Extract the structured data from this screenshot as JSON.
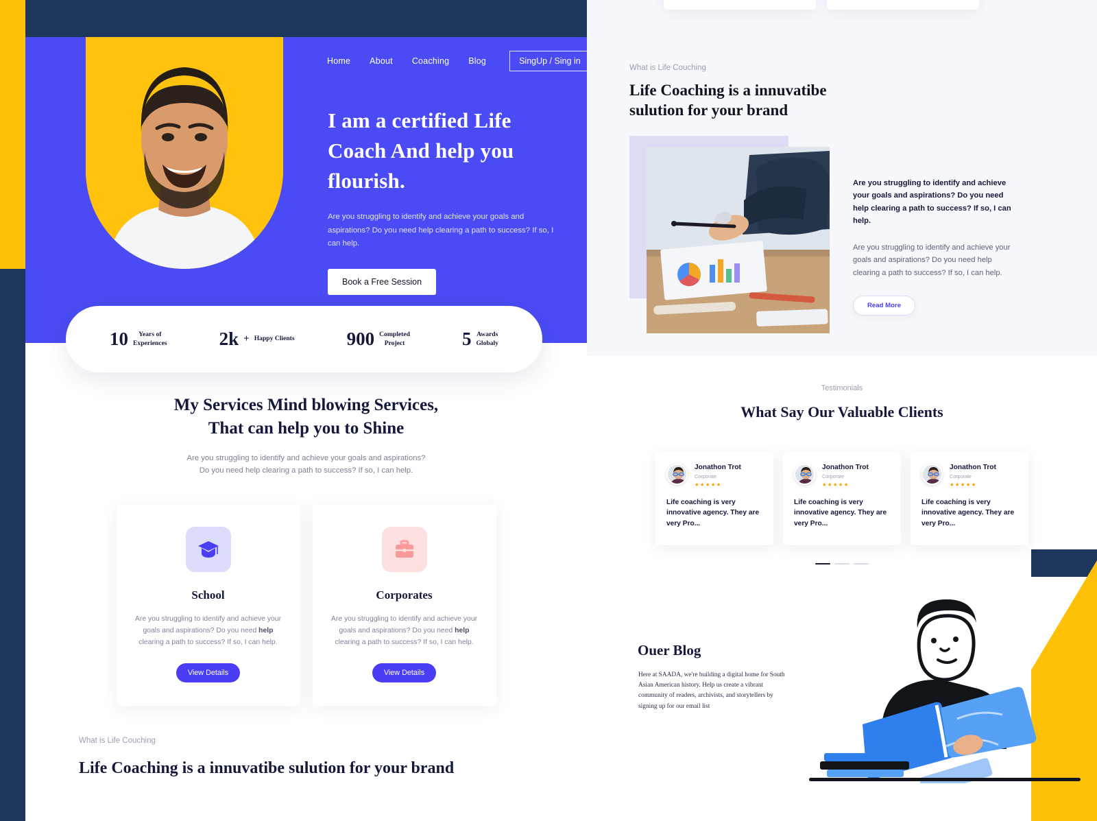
{
  "theme": {
    "primary_blue": "#4b4bf5",
    "button_blue": "#4b3df5",
    "yellow": "#ffc107",
    "navy": "#1d365c",
    "dark_text": "#14183a",
    "star_gold": "#f0a500"
  },
  "left_page": {
    "nav": {
      "links": [
        {
          "label": "Home"
        },
        {
          "label": "About"
        },
        {
          "label": "Coaching"
        },
        {
          "label": "Blog"
        }
      ],
      "auth_button": "SingUp /  Sing in"
    },
    "hero": {
      "title": "I am a certified Life Coach And help you flourish.",
      "subtitle": "Are you struggling to identify and achieve your goals and aspirations? Do you need help clearing a path to success? If so, I can help.",
      "cta_label": "Book a Free Session"
    },
    "stats": [
      {
        "number": "10",
        "plus": "",
        "label_line1": "Years of",
        "label_line2": "Experiences"
      },
      {
        "number": "2k",
        "plus": "+",
        "label_line1": "Happy Clients",
        "label_line2": ""
      },
      {
        "number": "900",
        "plus": "",
        "label_line1": "Completed",
        "label_line2": "Project"
      },
      {
        "number": "5",
        "plus": "",
        "label_line1": "Awards",
        "label_line2": "Globaly"
      }
    ],
    "services": {
      "title_line1": "My Services Mind blowing Services,",
      "title_line2": "That can help you to Shine",
      "subtitle_line1": "Are you struggling to identify and achieve your goals and aspirations?",
      "subtitle_line2": "Do you need help clearing a path to success? If so, I can help.",
      "cards": [
        {
          "icon": "graduation-cap-icon",
          "name": "School",
          "desc_pre": "Are you struggling to identify and achieve your goals and aspirations? Do you need ",
          "desc_bold": "help",
          "desc_post": " clearing a path to success? If so, I can help.",
          "button": "View Details"
        },
        {
          "icon": "briefcase-icon",
          "name": "Corporates",
          "desc_pre": "Are you struggling to identify and achieve your goals and aspirations? Do you need ",
          "desc_bold": "help",
          "desc_post": " clearing a path to success? If so, I can help.",
          "button": "View Details"
        }
      ]
    },
    "bottom_section": {
      "eyebrow": "What is Life Couching",
      "heading": "Life Coaching is a innuvatibe sulution for your brand"
    }
  },
  "right_page": {
    "about": {
      "eyebrow": "What is Life Couching",
      "heading": "Life Coaching is a innuvatibe sulution for your brand",
      "paragraph_1": "Are you struggling to identify and achieve your goals and aspirations? Do you need help clearing a path to success? If so, I can help.",
      "paragraph_2": "Are you struggling to identify and achieve your goals and aspirations? Do you need help clearing a path to success? If so, I can help.",
      "read_more": "Read More"
    },
    "testimonials": {
      "eyebrow": "Testimonials",
      "title": "What Say Our Valuable Clients",
      "cards": [
        {
          "name": "Jonathon Trot",
          "role": "Corporate",
          "stars": "★★★★★",
          "text": "Life coaching is very innovative agency. They are very Pro..."
        },
        {
          "name": "Jonathon Trot",
          "role": "Corporate",
          "stars": "★★★★★",
          "text": "Life coaching is very innovative agency. They are very Pro..."
        },
        {
          "name": "Jonathon Trot",
          "role": "Corporate",
          "stars": "★★★★★",
          "text": "Life coaching is very innovative agency. They are very Pro..."
        }
      ],
      "dots": 3,
      "active_dot": 0
    },
    "blog": {
      "title": "Ouer Blog",
      "text": "Here at SAADA, we're building a digital home for South Asian American history. Help us create a vibrant community of readers, archivists, and storytellers by signing up for our email list"
    }
  }
}
